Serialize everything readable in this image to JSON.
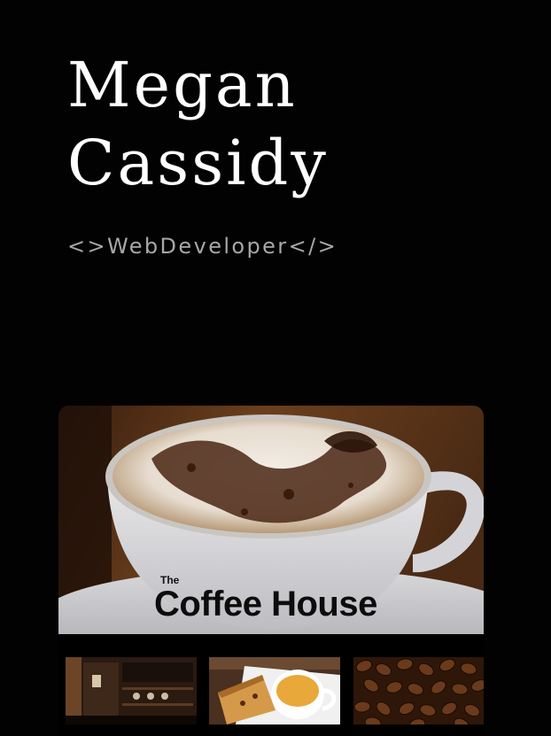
{
  "header": {
    "first_name": "Megan",
    "last_name": "Cassidy",
    "tagline": "<>WebDeveloper</>"
  },
  "project": {
    "brand_small": "The",
    "brand_name": "Coffee House",
    "thumbnails": [
      "cafe-interior-photo",
      "cake-and-coffee-photo",
      "coffee-beans-photo"
    ]
  },
  "colors": {
    "background": "#020202",
    "name_text": "#ffffff",
    "tagline_text": "#a7a7a7"
  }
}
